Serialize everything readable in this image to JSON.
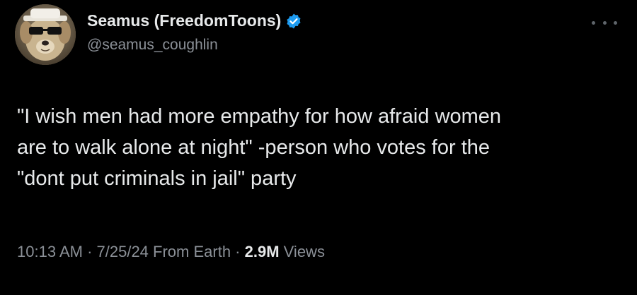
{
  "author": {
    "display_name": "Seamus (FreedomToons)",
    "handle": "@seamus_coughlin",
    "verified_icon": "verified-badge-icon",
    "verified_color": "#1d9bf0"
  },
  "more_menu_icon": "more-options-icon",
  "tweet": {
    "lines": [
      "\"I wish men had more empathy for how afraid women",
      "are to walk alone at night\" -person who votes for the",
      "\"dont put criminals in jail\" party"
    ]
  },
  "meta": {
    "time": "10:13 AM",
    "sep1": " · ",
    "date": "7/25/24",
    "source": " From Earth",
    "sep2": " · ",
    "views_count": "2.9M",
    "views_label": " Views"
  },
  "colors": {
    "background": "#000000",
    "text_primary": "#e7e9ea",
    "text_secondary": "#8b9097"
  }
}
